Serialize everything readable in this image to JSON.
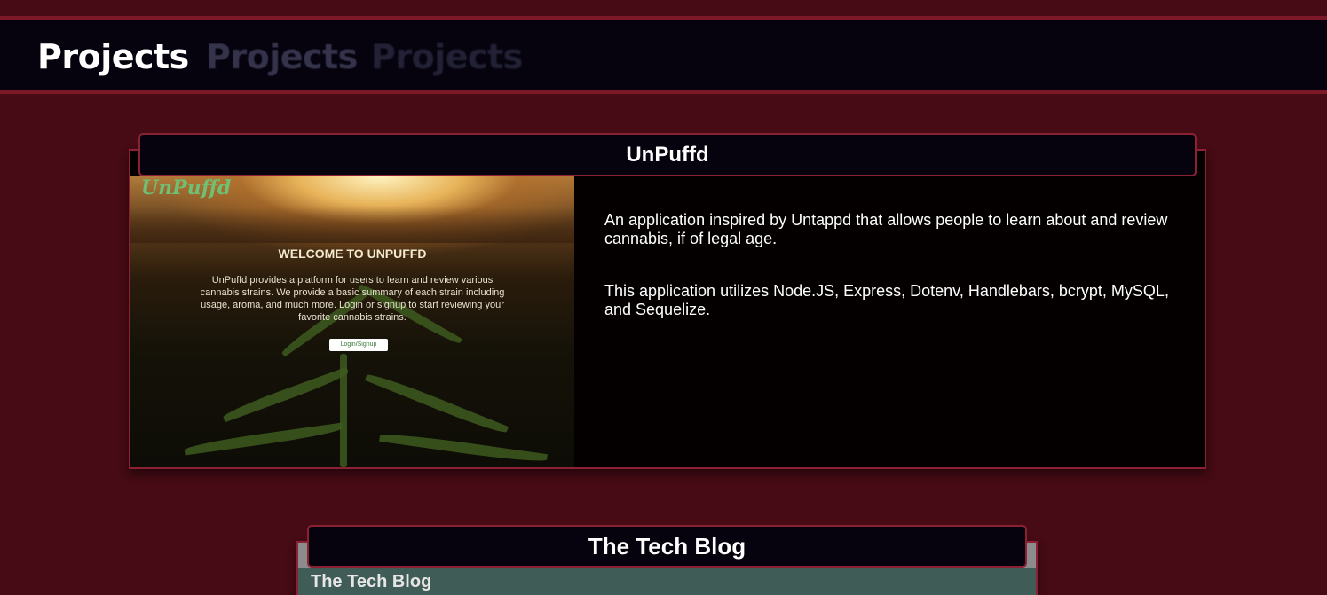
{
  "header": {
    "titles": [
      "Projects",
      "Projects",
      "Projects"
    ]
  },
  "projects": [
    {
      "title": "UnPuffd",
      "screenshot": {
        "logo": "UnPuffd",
        "heading": "WELCOME TO UNPUFFD",
        "text": "UnPuffd provides a platform for users to learn and review various cannabis strains. We provide a basic summary of each strain including usage, aroma, and much more. Login or signup to start reviewing your favorite cannabis strains.",
        "button": "Login/Signup"
      },
      "description": [
        "An application inspired by Untappd that allows people to learn about and review cannabis, if of legal age.",
        "This application utilizes Node.JS, Express, Dotenv, Handlebars, bcrypt, MySQL, and Sequelize."
      ]
    },
    {
      "title": "The Tech Blog",
      "screenshot": {
        "heading": "The Tech Blog"
      }
    }
  ],
  "colors": {
    "background": "#460b14",
    "header_bg": "#06030f",
    "accent_border": "#8a2134",
    "card_bg": "#050000",
    "text": "#ffffff"
  }
}
